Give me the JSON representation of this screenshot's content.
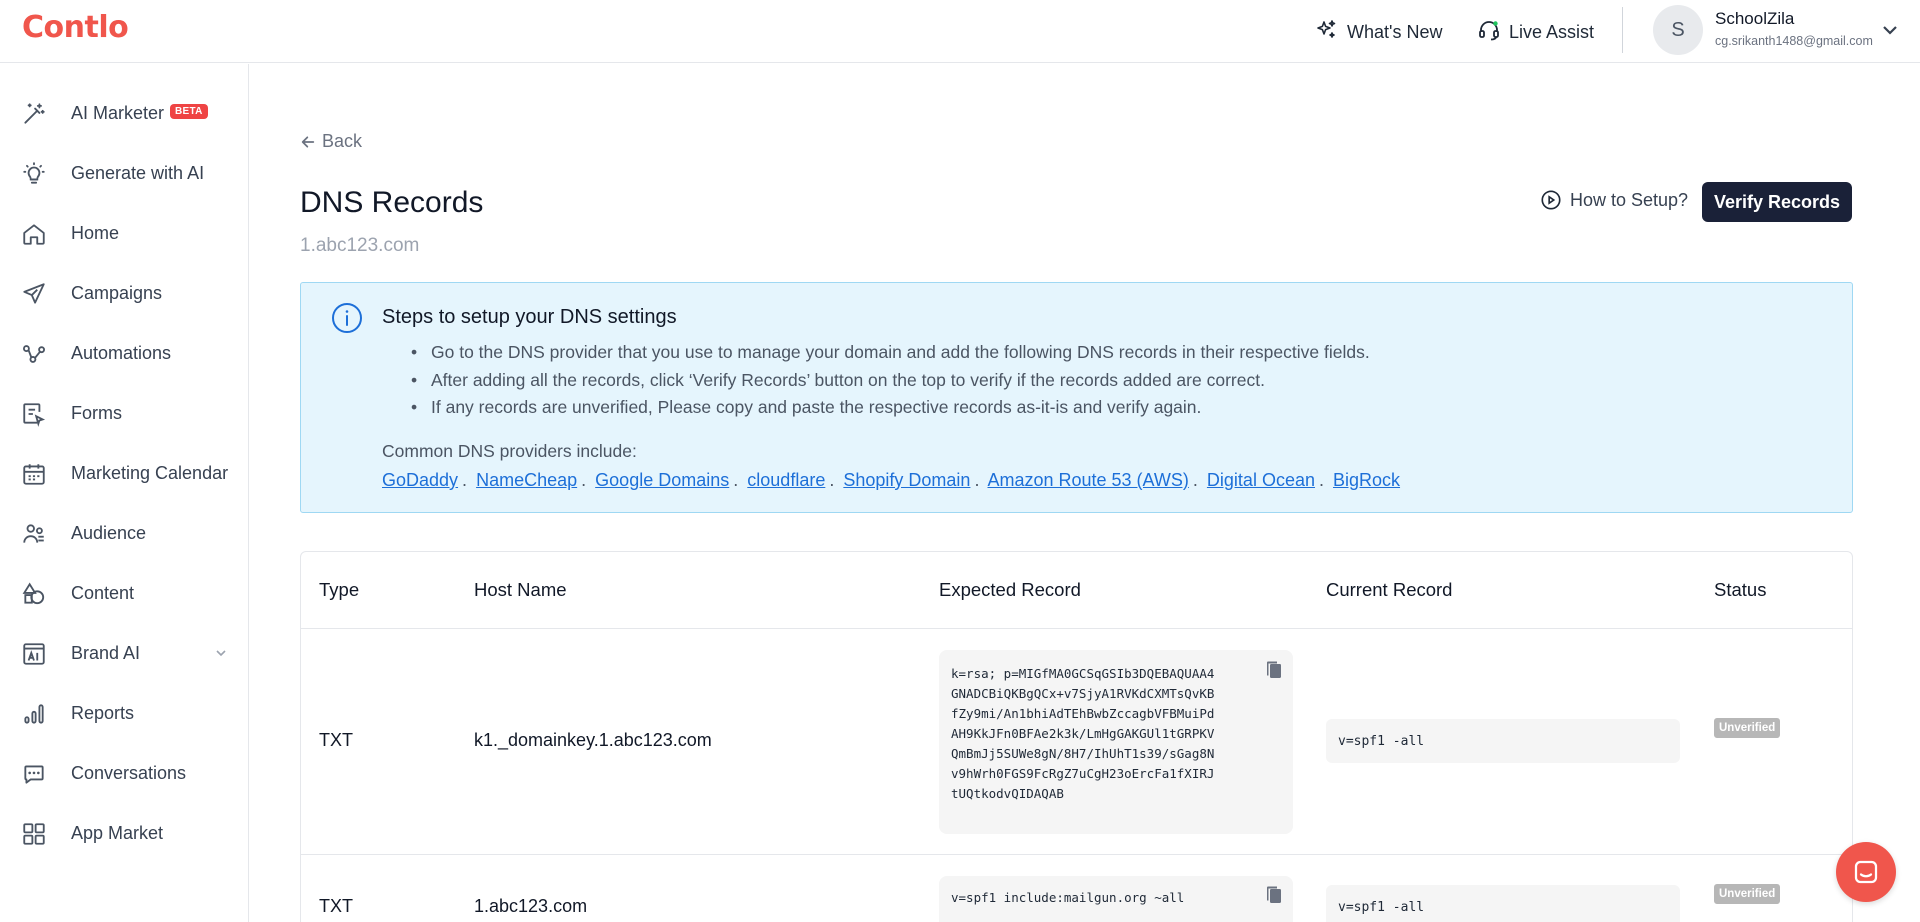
{
  "app": {
    "logo": "Contlo"
  },
  "topbar": {
    "whats_new": "What's New",
    "live_assist": "Live Assist",
    "user": {
      "initial": "S",
      "name": "SchoolZila",
      "email": "cg.srikanth1488@gmail.com"
    }
  },
  "sidebar": {
    "items": [
      {
        "label": "AI Marketer",
        "icon": "magic-wand-icon",
        "badge": "BETA"
      },
      {
        "label": "Generate with AI",
        "icon": "lightbulb-icon"
      },
      {
        "label": "Home",
        "icon": "home-icon"
      },
      {
        "label": "Campaigns",
        "icon": "paper-plane-icon"
      },
      {
        "label": "Automations",
        "icon": "flow-icon"
      },
      {
        "label": "Forms",
        "icon": "form-icon"
      },
      {
        "label": "Marketing Calendar",
        "icon": "calendar-icon"
      },
      {
        "label": "Audience",
        "icon": "people-icon"
      },
      {
        "label": "Content",
        "icon": "shapes-icon"
      },
      {
        "label": "Brand AI",
        "icon": "ai-box-icon"
      },
      {
        "label": "Reports",
        "icon": "bar-chart-icon"
      },
      {
        "label": "Conversations",
        "icon": "chat-icon"
      },
      {
        "label": "App Market",
        "icon": "grid-icon"
      }
    ]
  },
  "main": {
    "back": "Back",
    "title": "DNS Records",
    "domain": "1.abc123.com",
    "how_to": "How to Setup?",
    "verify_button": "Verify Records",
    "info": {
      "title": "Steps to setup your DNS settings",
      "steps": [
        "Go to the DNS provider that you use to manage your domain and add the following DNS records in their respective fields.",
        "After adding all the records, click ‘Verify Records’ button on the top to verify if the records added are correct.",
        "If any records are unverified, Please copy and paste the respective records as-it-is and verify again."
      ],
      "providers_label": "Common DNS providers include:",
      "providers": [
        "GoDaddy",
        "NameCheap",
        "Google Domains",
        "cloudflare",
        "Shopify Domain",
        "Amazon Route 53 (AWS)",
        "Digital Ocean",
        "BigRock"
      ]
    },
    "table": {
      "headers": [
        "Type",
        "Host Name",
        "Expected Record",
        "Current Record",
        "Status"
      ],
      "rows": [
        {
          "type": "TXT",
          "host": "k1._domainkey.1.abc123.com",
          "expected": "k=rsa; p=MIGfMA0GCSqGSIb3DQEBAQUAA4GNADCBiQKBgQCx+v7SjyA1RVKdCXMTsQvKBfZy9mi/An1bhiAdTEhBwbZccagbVFBMuiPdAH9KkJFn0BFAe2k3k/LmHgGAKGUl1tGRPKVQmBmJj5SUWe8gN/8H7/IhUhT1s39/sGag8Nv9hWrh0FGS9FcRgZ7uCgH23oErcFa1fXIRJtUQtkodvQIDAQAB",
          "current": "v=spf1 -all",
          "status": "Unverified"
        },
        {
          "type": "TXT",
          "host": "1.abc123.com",
          "expected": "v=spf1 include:mailgun.org ~all",
          "current": "v=spf1 -all",
          "status": "Unverified"
        }
      ]
    }
  },
  "colors": {
    "brand": "#f0564c",
    "primary_button": "#1a2138",
    "info_bg": "#e5f5fd",
    "link": "#1d6fd8"
  }
}
